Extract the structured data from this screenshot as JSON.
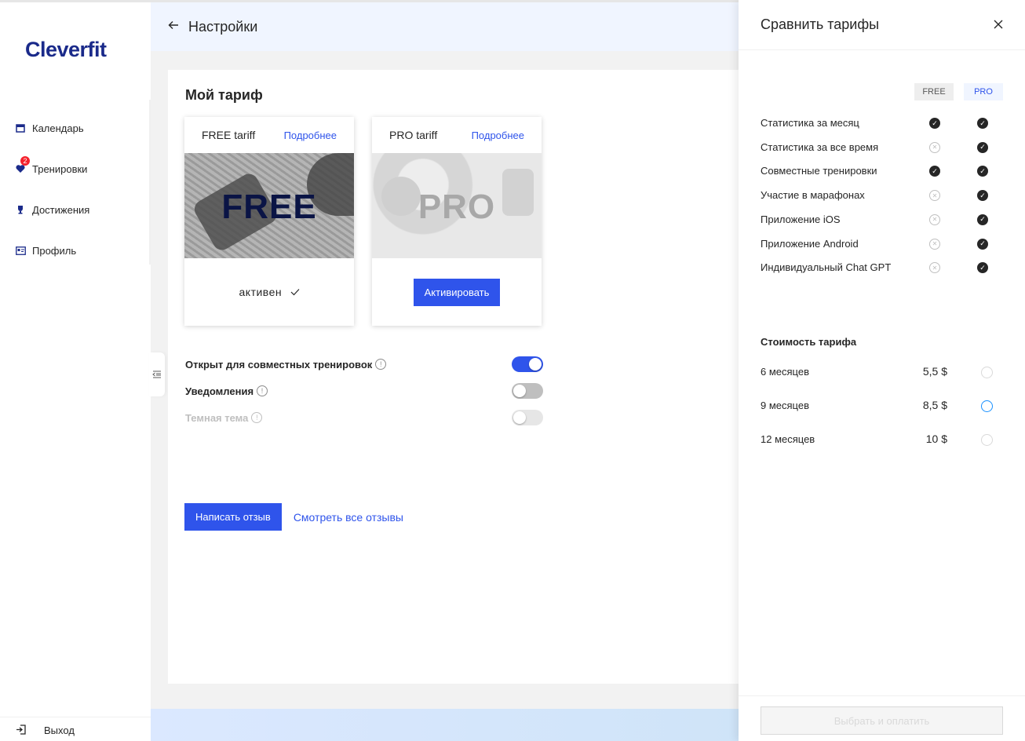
{
  "app": {
    "logo": "Cleverfit"
  },
  "sidebar": {
    "items": [
      {
        "label": "Календарь",
        "icon": "calendar-icon"
      },
      {
        "label": "Тренировки",
        "icon": "heart-icon",
        "badge": "2"
      },
      {
        "label": "Достижения",
        "icon": "trophy-icon"
      },
      {
        "label": "Профиль",
        "icon": "profile-card-icon"
      }
    ],
    "logout_label": "Выход"
  },
  "header": {
    "title": "Настройки"
  },
  "tariff": {
    "section_title": "Мой тариф",
    "cards": [
      {
        "name": "FREE tariff",
        "more": "Подробнее",
        "image_text": "FREE",
        "status": "активен"
      },
      {
        "name": "PRO tariff",
        "more": "Подробнее",
        "image_text": "PRO",
        "action": "Активировать"
      }
    ]
  },
  "settings": [
    {
      "label": "Открыт для совместных тренировок",
      "state": "on"
    },
    {
      "label": "Уведомления",
      "state": "off"
    },
    {
      "label": "Темная тема",
      "state": "disabled"
    }
  ],
  "reviews": {
    "write_label": "Написать отзыв",
    "view_all_label": "Смотреть все отзывы"
  },
  "drawer": {
    "title": "Сравнить тарифы",
    "columns": [
      "FREE",
      "PRO"
    ],
    "features": [
      {
        "name": "Статистика за месяц",
        "free": true,
        "pro": true
      },
      {
        "name": "Статистика за все время",
        "free": false,
        "pro": true
      },
      {
        "name": "Совместные тренировки",
        "free": true,
        "pro": true
      },
      {
        "name": "Участие в марафонах",
        "free": false,
        "pro": true
      },
      {
        "name": "Приложение iOS",
        "free": false,
        "pro": true
      },
      {
        "name": "Приложение Android",
        "free": false,
        "pro": true
      },
      {
        "name": "Индивидуальный Chat GPT",
        "free": false,
        "pro": true
      }
    ],
    "price_title": "Стоимость тарифа",
    "prices": [
      {
        "period": "6 месяцев",
        "price": "5,5 $",
        "selected": false
      },
      {
        "period": "9 месяцев",
        "price": "8,5 $",
        "selected": true
      },
      {
        "period": "12 месяцев",
        "price": "10 $",
        "selected": false
      }
    ],
    "pay_label": "Выбрать и оплатить"
  },
  "colors": {
    "primary": "#2f54eb",
    "brand": "#1a2a8a",
    "header_bg": "#f0f5ff",
    "badge": "#f5222d"
  }
}
